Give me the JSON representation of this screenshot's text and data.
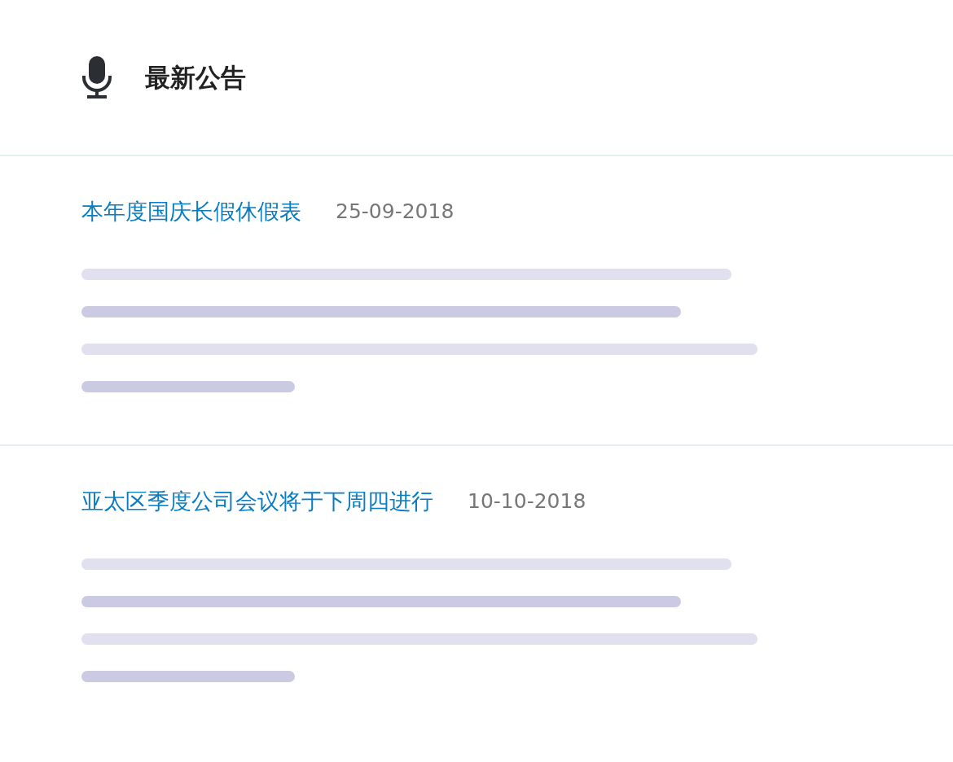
{
  "header": {
    "title": "最新公告"
  },
  "announcements": [
    {
      "title": "本年度国庆长假休假表",
      "date": "25-09-2018"
    },
    {
      "title": "亚太区季度公司会议将于下周四进行",
      "date": "10-10-2018"
    }
  ]
}
